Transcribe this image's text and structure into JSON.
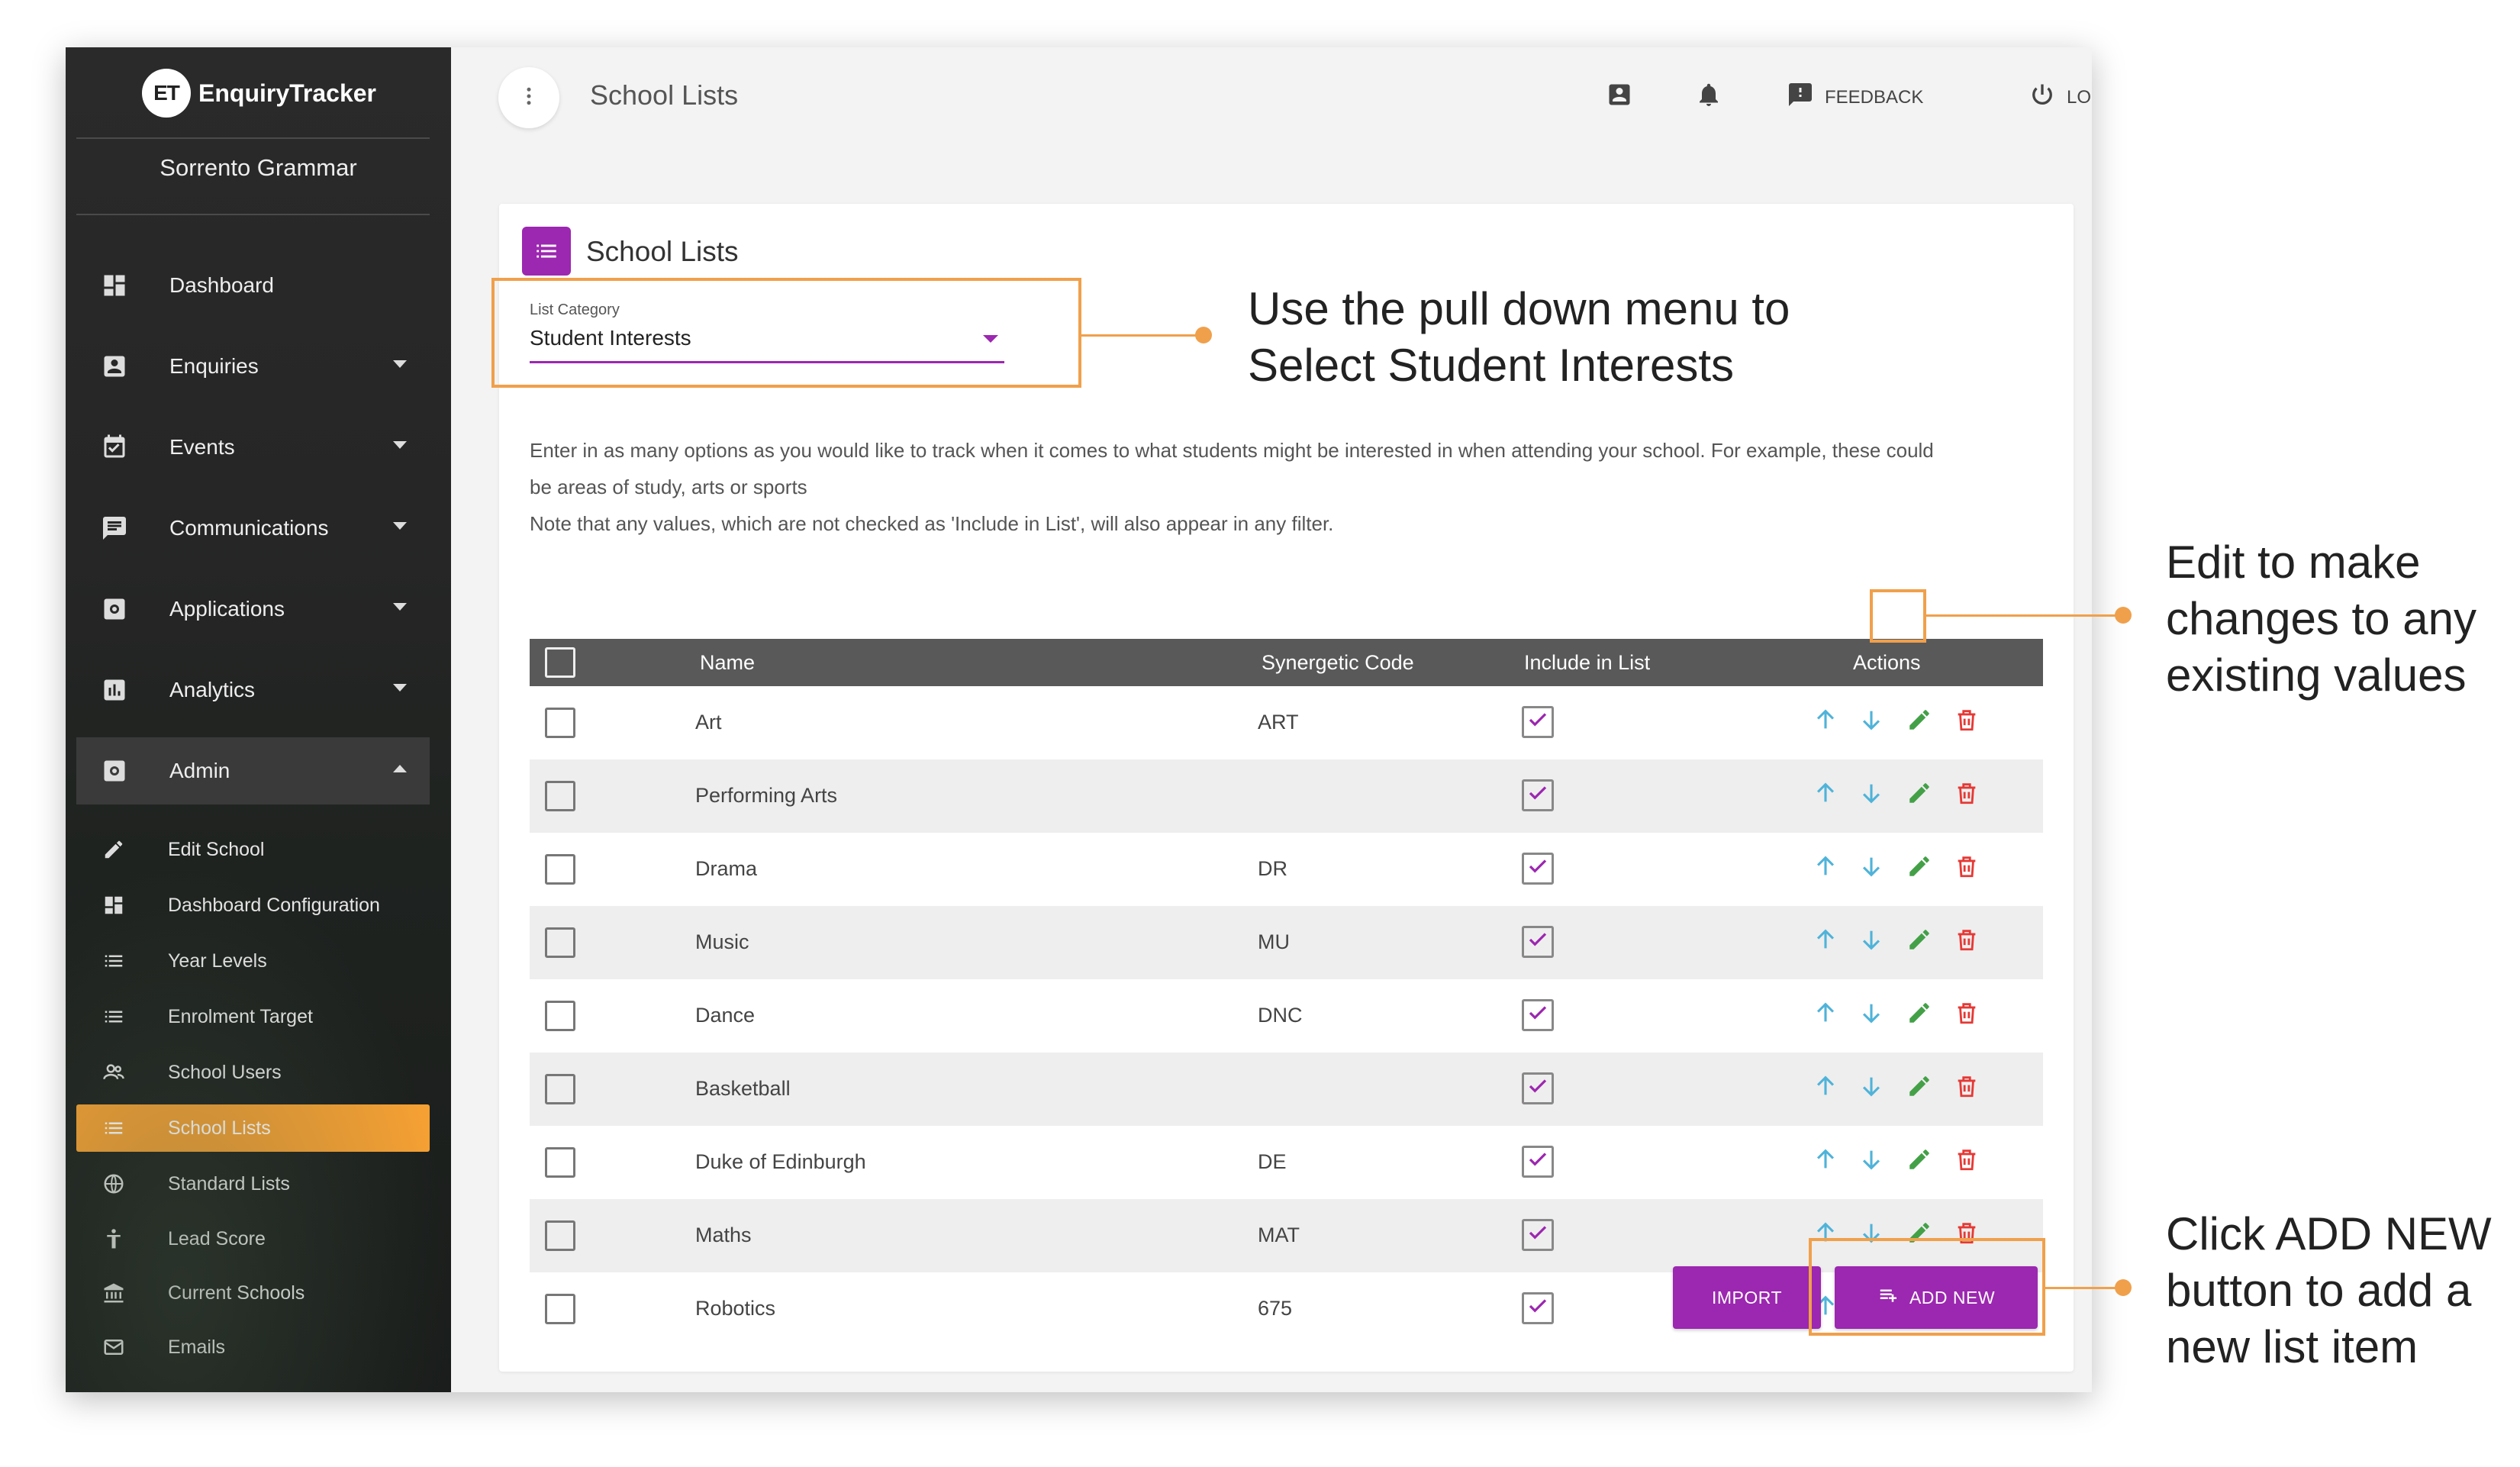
{
  "brand": {
    "badge": "ET",
    "name": "EnquiryTracker"
  },
  "school_name": "Sorrento Grammar",
  "sidebar": {
    "items": [
      {
        "label": "Dashboard",
        "icon": "dashboard-icon",
        "has_caret": false
      },
      {
        "label": "Enquiries",
        "icon": "contact-icon",
        "has_caret": true
      },
      {
        "label": "Events",
        "icon": "calendar-check-icon",
        "has_caret": true
      },
      {
        "label": "Communications",
        "icon": "message-icon",
        "has_caret": true
      },
      {
        "label": "Applications",
        "icon": "settings-box-icon",
        "has_caret": true
      },
      {
        "label": "Analytics",
        "icon": "bar-chart-icon",
        "has_caret": true
      },
      {
        "label": "Admin",
        "icon": "settings-box-icon",
        "has_caret": true,
        "open": true
      }
    ],
    "sub_items": [
      {
        "label": "Edit School",
        "icon": "pencil-icon"
      },
      {
        "label": "Dashboard Configuration",
        "icon": "dashboard-icon"
      },
      {
        "label": "Year Levels",
        "icon": "list-icon"
      },
      {
        "label": "Enrolment Target",
        "icon": "list-icon"
      },
      {
        "label": "School Users",
        "icon": "users-icon"
      },
      {
        "label": "School Lists",
        "icon": "list-icon",
        "active": true
      },
      {
        "label": "Standard Lists",
        "icon": "globe-icon"
      },
      {
        "label": "Lead Score",
        "icon": "person-icon"
      },
      {
        "label": "Current Schools",
        "icon": "bank-icon"
      },
      {
        "label": "Emails",
        "icon": "mail-icon"
      }
    ]
  },
  "topbar": {
    "title": "School Lists",
    "feedback_label": "FEEDBACK",
    "logout_label": "LOGOUT"
  },
  "card": {
    "title": "School Lists",
    "select_label": "List Category",
    "select_value": "Student Interests",
    "desc_line1": "Enter in as many options as you would like to track when it comes to what students might be interested in when attending your school. For example, these could",
    "desc_line2": "be areas of study, arts or sports",
    "desc_line3": "Note that any values, which are not checked as 'Include in List', will also appear in any filter."
  },
  "table": {
    "headers": {
      "name": "Name",
      "code": "Synergetic Code",
      "include": "Include in List",
      "actions": "Actions"
    },
    "rows": [
      {
        "name": "Art",
        "code": "ART",
        "include": true
      },
      {
        "name": "Performing Arts",
        "code": "",
        "include": true
      },
      {
        "name": "Drama",
        "code": "DR",
        "include": true
      },
      {
        "name": "Music",
        "code": "MU",
        "include": true
      },
      {
        "name": "Dance",
        "code": "DNC",
        "include": true
      },
      {
        "name": "Basketball",
        "code": "",
        "include": true
      },
      {
        "name": "Duke of Edinburgh",
        "code": "DE",
        "include": true
      },
      {
        "name": "Maths",
        "code": "MAT",
        "include": true
      },
      {
        "name": "Robotics",
        "code": "675",
        "include": true
      }
    ]
  },
  "buttons": {
    "import": "IMPORT",
    "add_new": "ADD NEW"
  },
  "annotations": {
    "select_line1": "Use the pull down menu to",
    "select_line2": "Select Student Interests",
    "edit_line1": "Edit to make",
    "edit_line2": "changes to any",
    "edit_line3": "existing values",
    "add_line1": "Click ADD NEW",
    "add_line2": "button to add a",
    "add_line3": "new list item"
  },
  "colors": {
    "accent": "#9c27b0",
    "active_nav": "#f5a033",
    "annotation": "#f0a04b",
    "arrow_icon": "#4fb3d9",
    "edit_icon": "#43a047",
    "delete_icon": "#e53935"
  }
}
